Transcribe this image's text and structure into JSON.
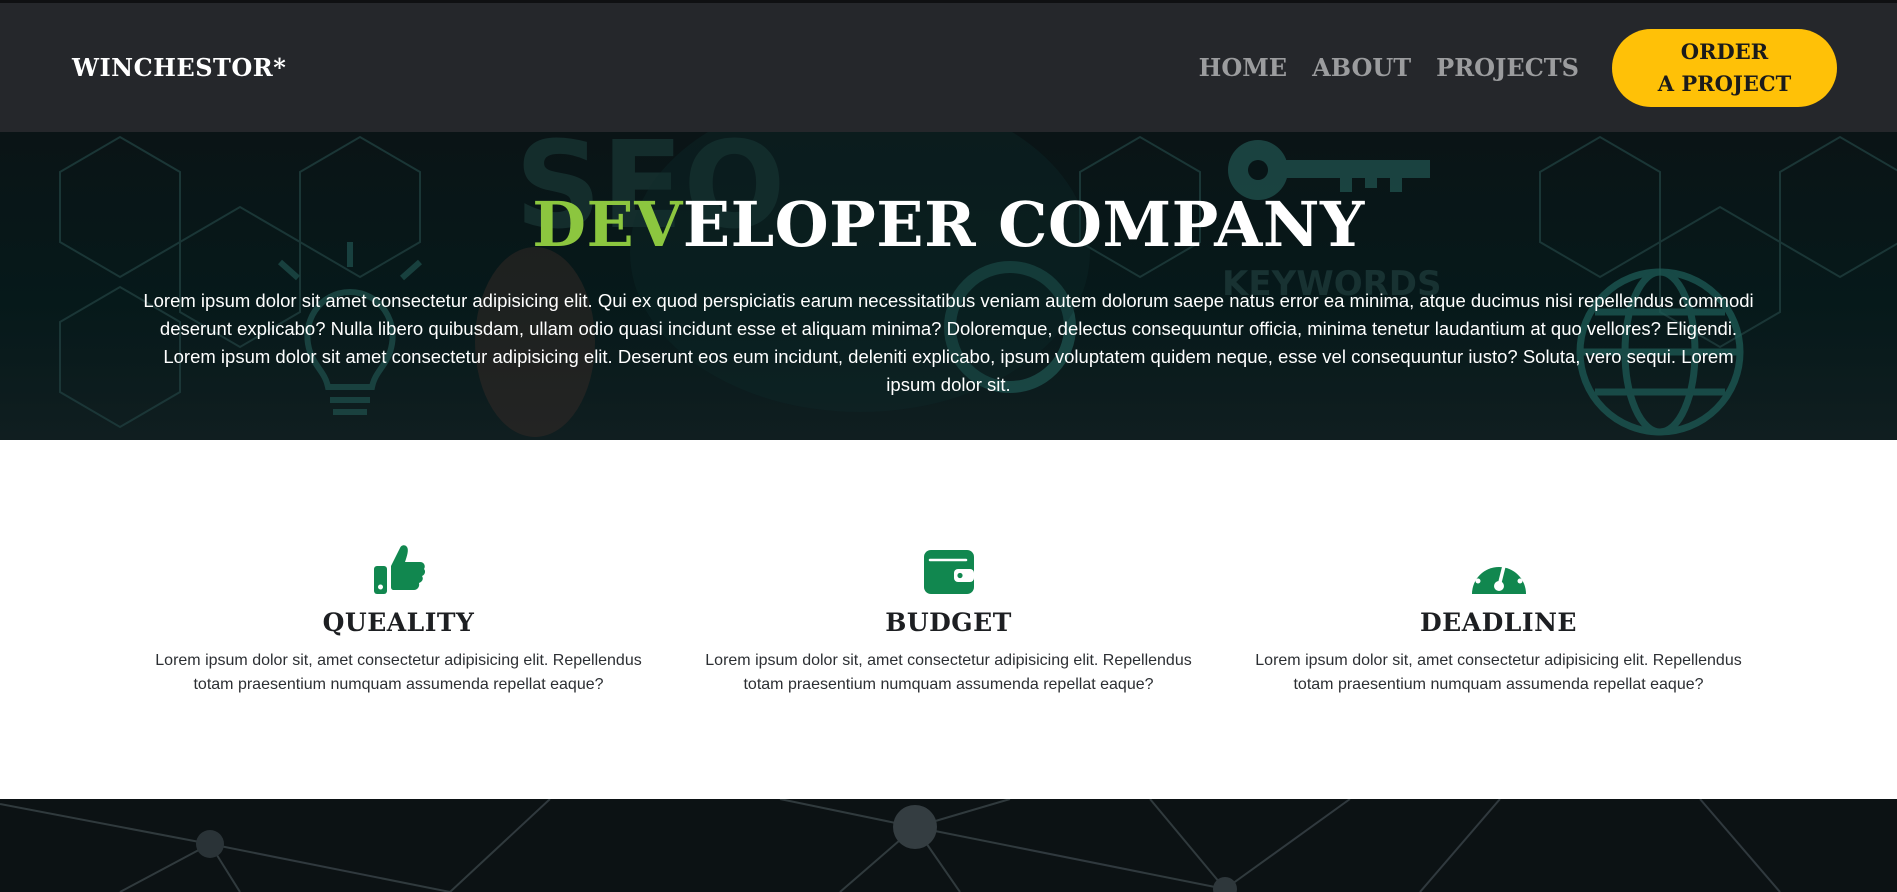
{
  "header": {
    "brand": "WINCHESTOR*",
    "nav": [
      "HOME",
      "ABOUT",
      "PROJECTS"
    ],
    "cta_line1": "ORDER",
    "cta_line2": "A PROJECT"
  },
  "hero": {
    "title_accent": "DEV",
    "title_rest": "ELOPER COMPANY",
    "paragraph": "Lorem ipsum dolor sit amet consectetur adipisicing elit. Qui ex quod perspiciatis earum necessitatibus veniam autem dolorum saepe natus error ea minima, atque ducimus nisi repellendus commodi deserunt explicabo? Nulla libero quibusdam, ullam odio quasi incidunt esse et aliquam minima? Doloremque, delectus consequuntur officia, minima tenetur laudantium at quo vellores? Eligendi. Lorem ipsum dolor sit amet consectetur adipisicing elit. Deserunt eos eum incidunt, deleniti explicabo, ipsum voluptatem quidem neque, esse vel consequuntur iusto? Soluta, vero sequi. Lorem ipsum dolor sit.",
    "bg_words": [
      "SEO",
      "KEYWORDS"
    ]
  },
  "features": [
    {
      "icon": "thumbs-up-icon",
      "title": "QUEALITY",
      "text": "Lorem ipsum dolor sit, amet consectetur adipisicing elit. Repellendus totam praesentium numquam assumenda repellat eaque?"
    },
    {
      "icon": "wallet-icon",
      "title": "BUDGET",
      "text": "Lorem ipsum dolor sit, amet consectetur adipisicing elit. Repellendus totam praesentium numquam assumenda repellat eaque?"
    },
    {
      "icon": "gauge-icon",
      "title": "DEADLINE",
      "text": "Lorem ipsum dolor sit, amet consectetur adipisicing elit. Repellendus totam praesentium numquam assumenda repellat eaque?"
    }
  ],
  "colors": {
    "accent_green": "#8cc63f",
    "icon_green": "#11874f",
    "cta_yellow": "#ffc107",
    "nav_bg": "#25272b"
  }
}
